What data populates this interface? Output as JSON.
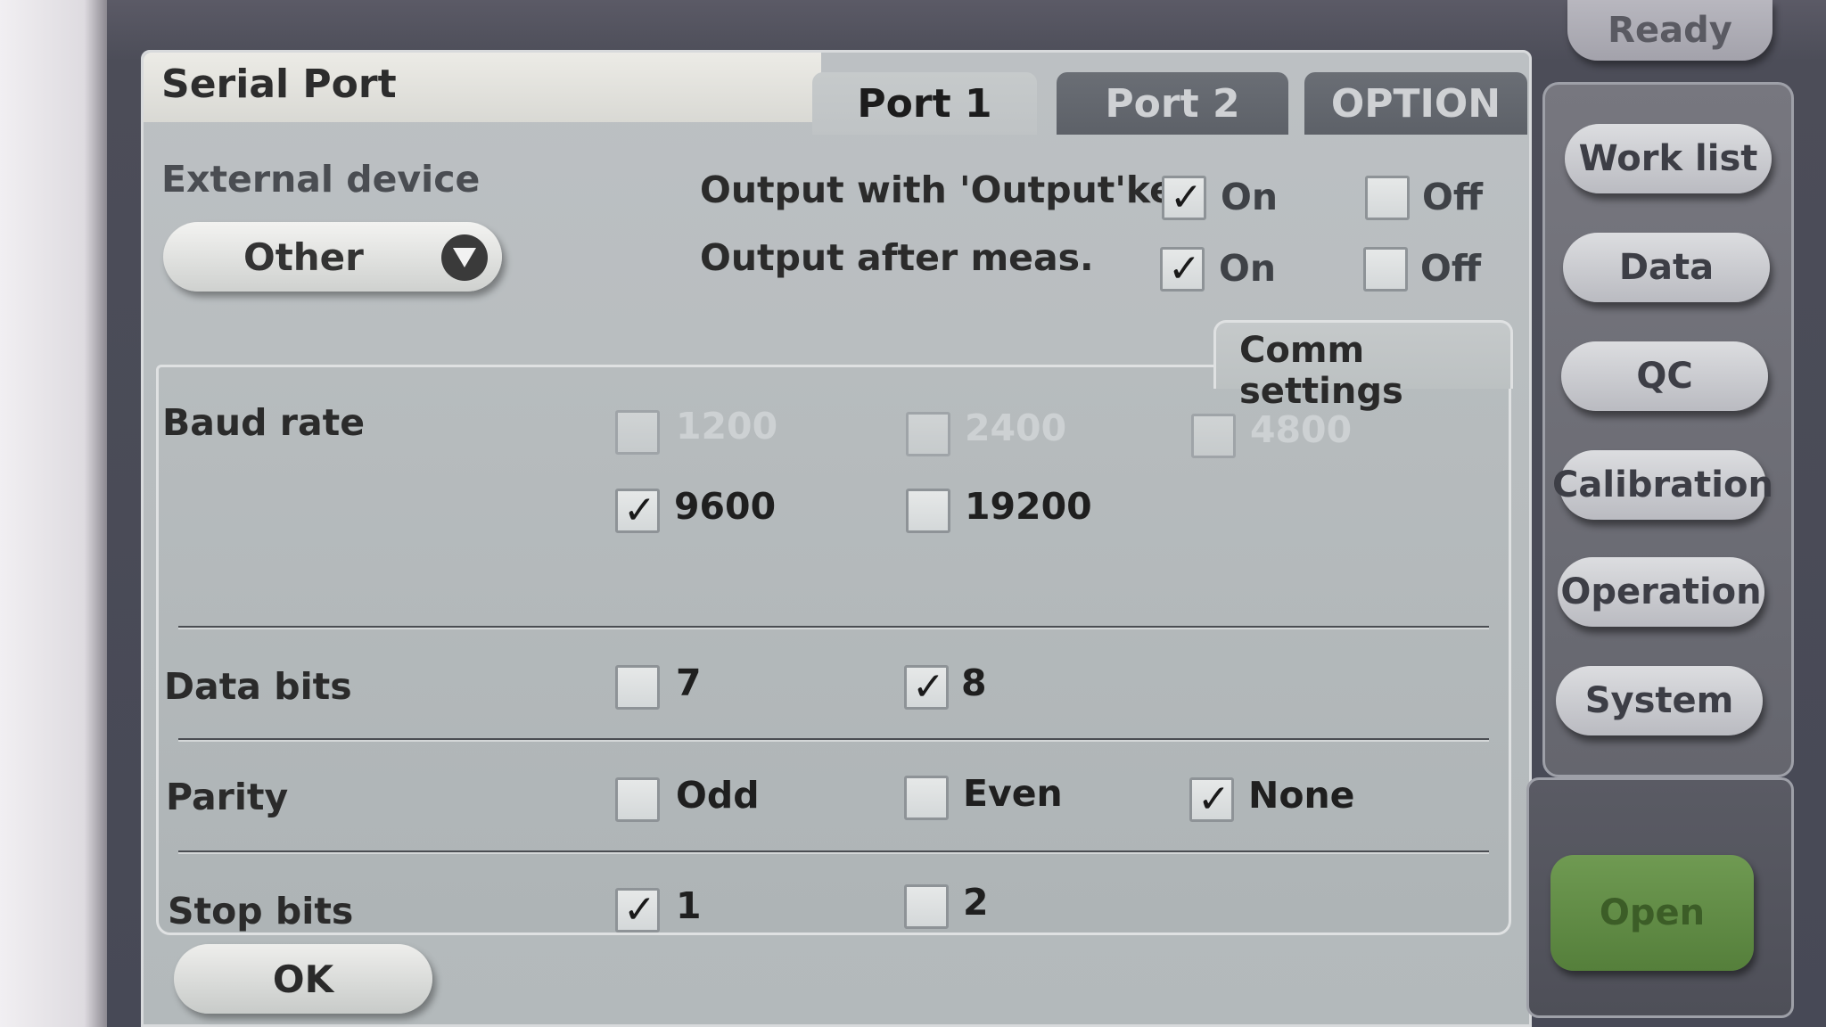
{
  "window": {
    "title": "Serial Port"
  },
  "tabs": [
    {
      "label": "Port 1",
      "active": true
    },
    {
      "label": "Port 2",
      "active": false
    },
    {
      "label": "OPTION",
      "active": false
    }
  ],
  "external_device": {
    "label": "External device",
    "value": "Other"
  },
  "output_key": {
    "label": "Output with 'Output'key",
    "on_label": "On",
    "off_label": "Off",
    "on_checked": true,
    "off_checked": false
  },
  "output_after": {
    "label": "Output after meas.",
    "on_label": "On",
    "off_label": "Off",
    "on_checked": true,
    "off_checked": false
  },
  "comm_settings": {
    "tab_label": "Comm settings",
    "baud_rate": {
      "label": "Baud rate",
      "options": [
        {
          "label": "1200",
          "checked": false,
          "enabled": false
        },
        {
          "label": "2400",
          "checked": false,
          "enabled": false
        },
        {
          "label": "4800",
          "checked": false,
          "enabled": false
        },
        {
          "label": "9600",
          "checked": true,
          "enabled": true
        },
        {
          "label": "19200",
          "checked": false,
          "enabled": true
        }
      ]
    },
    "data_bits": {
      "label": "Data bits",
      "options": [
        {
          "label": "7",
          "checked": false
        },
        {
          "label": "8",
          "checked": true
        }
      ]
    },
    "parity": {
      "label": "Parity",
      "options": [
        {
          "label": "Odd",
          "checked": false
        },
        {
          "label": "Even",
          "checked": false
        },
        {
          "label": "None",
          "checked": true
        }
      ]
    },
    "stop_bits": {
      "label": "Stop bits",
      "options": [
        {
          "label": "1",
          "checked": true
        },
        {
          "label": "2",
          "checked": false
        }
      ]
    }
  },
  "ok_button": "OK",
  "side": {
    "status": "Ready",
    "buttons": [
      "Work list",
      "Data",
      "QC",
      "Calibration",
      "Operation",
      "System"
    ],
    "open_button": "Open"
  }
}
